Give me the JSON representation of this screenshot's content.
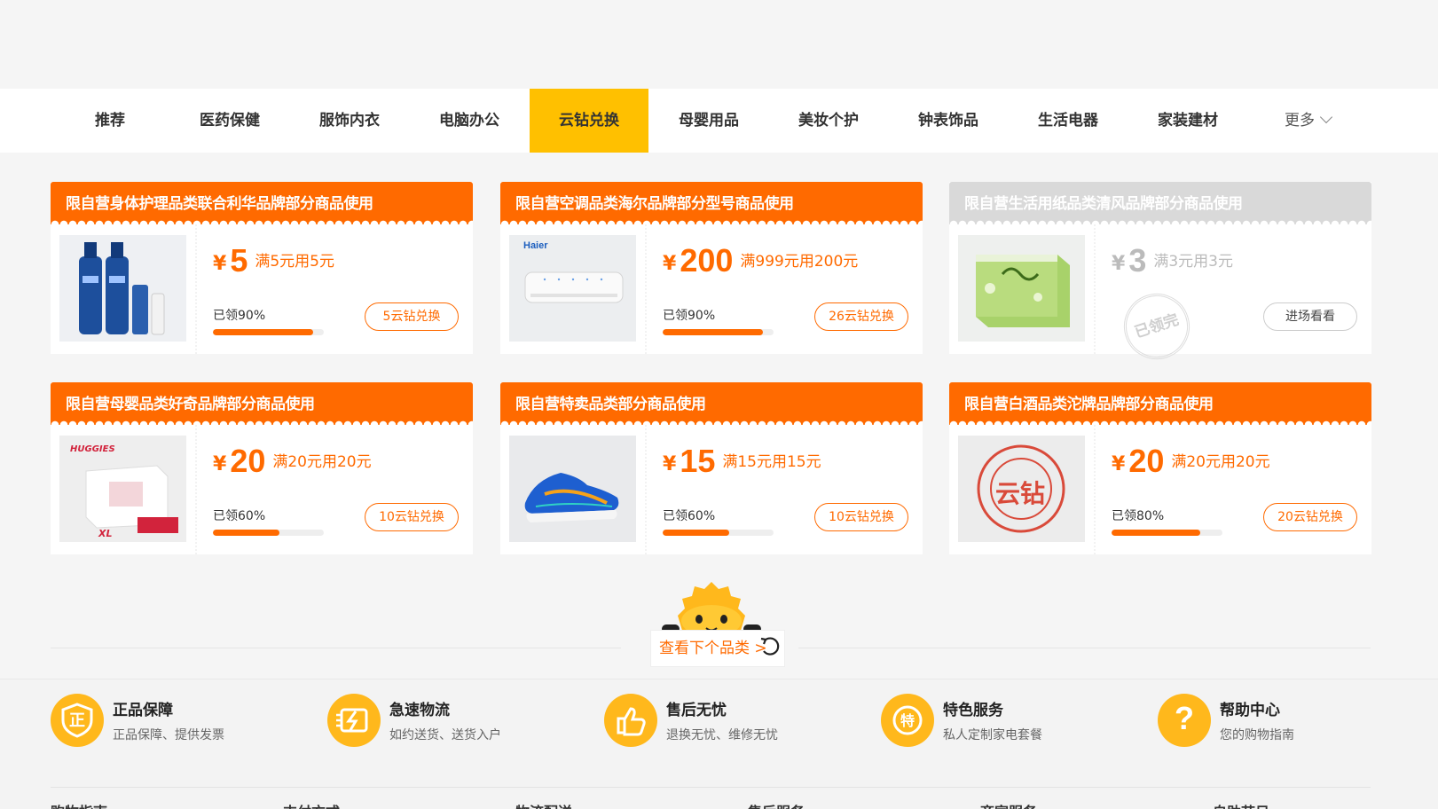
{
  "nav": {
    "items": [
      "推荐",
      "医药保健",
      "服饰内衣",
      "电脑办公",
      "云钻兑换",
      "母婴用品",
      "美妆个护",
      "钟表饰品",
      "生活电器",
      "家装建材"
    ],
    "active_index": 4,
    "more": "更多",
    "active_color": "#ffc000"
  },
  "coupons": [
    {
      "title": "限自营身体护理品类联合利华品牌部分商品使用",
      "yen": "¥",
      "amount": "5",
      "condition": "满5元用5元",
      "claimed": "已领90%",
      "progress": 0.9,
      "button": "5云钻兑换",
      "product": "clear-shampoo-image"
    },
    {
      "title": "限自营空调品类海尔品牌部分型号商品使用",
      "yen": "¥",
      "amount": "200",
      "condition": "满999元用200元",
      "claimed": "已领90%",
      "progress": 0.9,
      "button": "26云钻兑换",
      "brand": "Haier",
      "product": "air-conditioner-image"
    },
    {
      "title": "限自营生活用纸品类清风品牌部分商品使用",
      "yen": "¥",
      "amount": "3",
      "condition": "满3元用3元",
      "stamp": "已领完",
      "button": "进场看看",
      "product": "tissue-box-image",
      "state": "sold-out"
    },
    {
      "title": "限自营母婴品类好奇品牌部分商品使用",
      "yen": "¥",
      "amount": "20",
      "condition": "满20元用20元",
      "claimed": "已领60%",
      "progress": 0.6,
      "button": "10云钻兑换",
      "brand": "HUGGIES",
      "size_label": "XL",
      "product": "diaper-pack-image"
    },
    {
      "title": "限自营特卖品类部分商品使用",
      "yen": "¥",
      "amount": "15",
      "condition": "满15元用15元",
      "claimed": "已领60%",
      "progress": 0.6,
      "button": "10云钻兑换",
      "product": "sneaker-image"
    },
    {
      "title": "限自营白酒品类沱牌品牌部分商品使用",
      "yen": "¥",
      "amount": "20",
      "condition": "满20元用20元",
      "claimed": "已领80%",
      "progress": 0.8,
      "button": "20云钻兑换",
      "seal_text": "云钻",
      "product": "yunzuan-seal-image"
    }
  ],
  "next_category": {
    "label": "查看下个品类 >"
  },
  "services": [
    {
      "title": "正品保障",
      "desc": "正品保障、提供发票",
      "icon": "genuine-icon",
      "glyph": "正"
    },
    {
      "title": "急速物流",
      "desc": "如约送货、送货入户",
      "icon": "logistics-icon"
    },
    {
      "title": "售后无忧",
      "desc": "退换无忧、维修无忧",
      "icon": "thumbs-up-icon"
    },
    {
      "title": "特色服务",
      "desc": "私人定制家电套餐",
      "icon": "special-service-icon",
      "glyph": "特"
    },
    {
      "title": "帮助中心",
      "desc": "您的购物指南",
      "icon": "help-icon",
      "glyph": "?"
    }
  ],
  "footer_columns": [
    "购物指南",
    "支付方式",
    "物流配送",
    "售后服务",
    "商家服务",
    "自助节日"
  ],
  "colors": {
    "accent": "#ff6a00",
    "nav_active": "#ffc000",
    "service_icon": "#ffb81c",
    "disabled": "#d9d9d9"
  }
}
